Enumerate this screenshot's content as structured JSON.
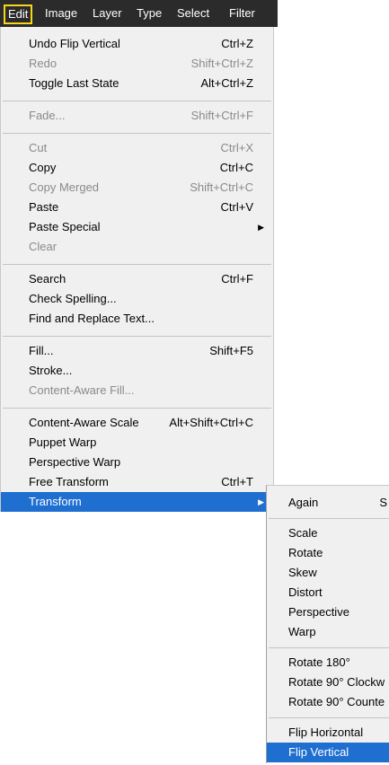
{
  "menubar": {
    "items": [
      "Edit",
      "Image",
      "Layer",
      "Type",
      "Select",
      "Filter"
    ]
  },
  "edit_menu": {
    "items": [
      {
        "label": "Undo Flip Vertical",
        "shortcut": "Ctrl+Z"
      },
      {
        "label": "Redo",
        "shortcut": "Shift+Ctrl+Z"
      },
      {
        "label": "Toggle Last State",
        "shortcut": "Alt+Ctrl+Z"
      },
      {
        "label": "Fade...",
        "shortcut": "Shift+Ctrl+F"
      },
      {
        "label": "Cut",
        "shortcut": "Ctrl+X"
      },
      {
        "label": "Copy",
        "shortcut": "Ctrl+C"
      },
      {
        "label": "Copy Merged",
        "shortcut": "Shift+Ctrl+C"
      },
      {
        "label": "Paste",
        "shortcut": "Ctrl+V"
      },
      {
        "label": "Paste Special",
        "shortcut": ""
      },
      {
        "label": "Clear",
        "shortcut": ""
      },
      {
        "label": "Search",
        "shortcut": "Ctrl+F"
      },
      {
        "label": "Check Spelling...",
        "shortcut": ""
      },
      {
        "label": "Find and Replace Text...",
        "shortcut": ""
      },
      {
        "label": "Fill...",
        "shortcut": "Shift+F5"
      },
      {
        "label": "Stroke...",
        "shortcut": ""
      },
      {
        "label": "Content-Aware Fill...",
        "shortcut": ""
      },
      {
        "label": "Content-Aware Scale",
        "shortcut": "Alt+Shift+Ctrl+C"
      },
      {
        "label": "Puppet Warp",
        "shortcut": ""
      },
      {
        "label": "Perspective Warp",
        "shortcut": ""
      },
      {
        "label": "Free Transform",
        "shortcut": "Ctrl+T"
      },
      {
        "label": "Transform",
        "shortcut": ""
      }
    ]
  },
  "transform_menu": {
    "items": [
      {
        "label": "Again"
      },
      {
        "label": "Scale"
      },
      {
        "label": "Rotate"
      },
      {
        "label": "Skew"
      },
      {
        "label": "Distort"
      },
      {
        "label": "Perspective"
      },
      {
        "label": "Warp"
      },
      {
        "label": "Rotate 180°"
      },
      {
        "label": "Rotate 90° Clockw"
      },
      {
        "label": "Rotate 90° Counte"
      },
      {
        "label": "Flip Horizontal"
      },
      {
        "label": "Flip Vertical"
      }
    ],
    "again_shortcut_fragment": "S"
  },
  "colors": {
    "menubar_bg": "#2b2b2b",
    "menu_bg": "#f0f0f0",
    "highlight": "#1f6fd1",
    "active_outline": "#f7d51d",
    "disabled_text": "#8a8a8a"
  }
}
